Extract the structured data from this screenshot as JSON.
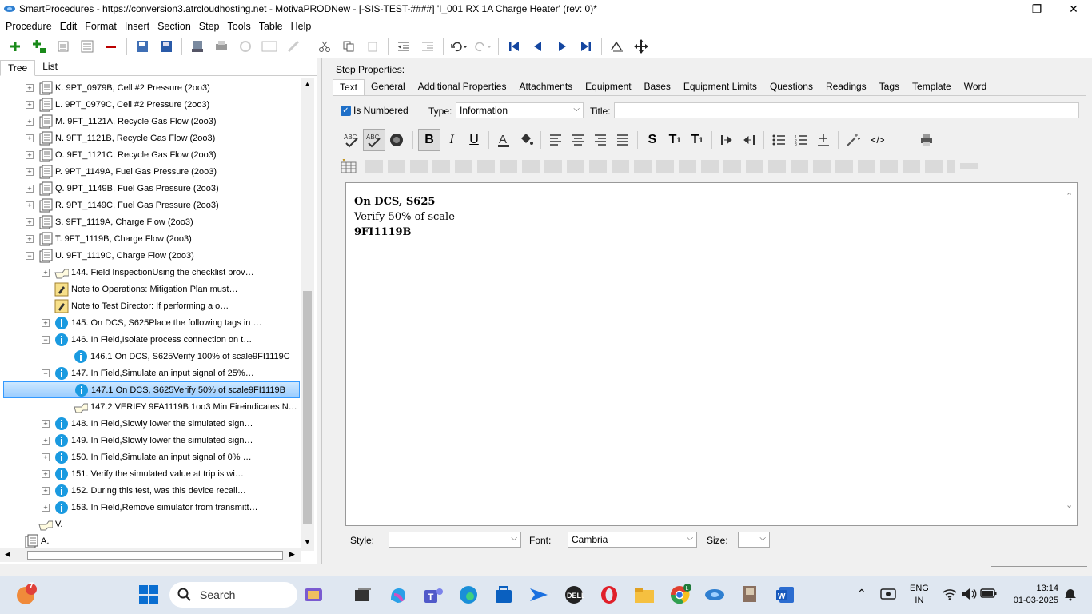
{
  "window": {
    "title": "SmartProcedures - https://conversion3.atrcloudhosting.net - MotivaPRODNew - [-SIS-TEST-####] 'I_001 RX 1A Charge Heater' (rev: 0)*",
    "minimize": "—",
    "restore": "❐",
    "close": "✕"
  },
  "menu": [
    "Procedure",
    "Edit",
    "Format",
    "Insert",
    "Section",
    "Step",
    "Tools",
    "Table",
    "Help"
  ],
  "left_tabs": [
    "Tree",
    "List"
  ],
  "tree": [
    {
      "expander": "+",
      "label": "K. 9PT_0979B, Cell #2 Pressure (2oo3)",
      "icon": "doc-icon",
      "indent": 0
    },
    {
      "expander": "+",
      "label": "L. 9PT_0979C, Cell #2 Pressure (2oo3)",
      "icon": "doc-icon",
      "indent": 0
    },
    {
      "expander": "+",
      "label": "M. 9FT_1121A, Recycle Gas Flow (2oo3)",
      "icon": "doc-icon",
      "indent": 0
    },
    {
      "expander": "+",
      "label": "N. 9FT_1121B, Recycle Gas Flow (2oo3)",
      "icon": "doc-icon",
      "indent": 0
    },
    {
      "expander": "+",
      "label": "O. 9FT_1121C, Recycle Gas Flow (2oo3)",
      "icon": "doc-icon",
      "indent": 0
    },
    {
      "expander": "+",
      "label": "P. 9PT_1149A, Fuel Gas Pressure (2oo3)",
      "icon": "doc-icon",
      "indent": 0
    },
    {
      "expander": "+",
      "label": "Q. 9PT_1149B, Fuel Gas Pressure (2oo3)",
      "icon": "doc-icon",
      "indent": 0
    },
    {
      "expander": "+",
      "label": "R. 9PT_1149C, Fuel Gas Pressure (2oo3)",
      "icon": "doc-icon",
      "indent": 0
    },
    {
      "expander": "+",
      "label": "S. 9FT_1119A, Charge Flow (2oo3)",
      "icon": "doc-icon",
      "indent": 0
    },
    {
      "expander": "+",
      "label": "T. 9FT_1119B, Charge Flow (2oo3)",
      "icon": "doc-icon",
      "indent": 0
    },
    {
      "expander": "−",
      "label": "U. 9FT_1119C, Charge Flow (2oo3)",
      "icon": "doc-icon",
      "indent": 0
    },
    {
      "expander": "+",
      "label": "144. Field InspectionUsing the checklist prov…",
      "icon": "hand-icon",
      "indent": 1
    },
    {
      "expander": "",
      "label": "Note to Operations: Mitigation Plan must…",
      "icon": "note-icon",
      "indent": 1
    },
    {
      "expander": "",
      "label": "Note to Test Director: If performing a o…",
      "icon": "note-icon",
      "indent": 1
    },
    {
      "expander": "+",
      "label": "145. On DCS, S625Place the following tags in …",
      "icon": "info-icon",
      "indent": 1
    },
    {
      "expander": "−",
      "label": "146. In Field,Isolate process connection on t…",
      "icon": "info-icon",
      "indent": 1
    },
    {
      "expander": "",
      "label": "146.1 On DCS, S625Verify 100% of scale9FI1119C",
      "icon": "info-icon",
      "indent": 2
    },
    {
      "expander": "−",
      "label": "147. In Field,Simulate an input signal of 25%…",
      "icon": "info-icon",
      "indent": 1
    },
    {
      "expander": "",
      "label": "147.1 On DCS, S625Verify 50% of scale9FI1119B",
      "icon": "info-icon",
      "indent": 2,
      "selected": true
    },
    {
      "expander": "",
      "label": "147.2 VERIFY 9FA1119B 1oo3 Min Fireindicates N…",
      "icon": "hand-icon",
      "indent": 2
    },
    {
      "expander": "+",
      "label": "148. In Field,Slowly lower the simulated sign…",
      "icon": "info-icon",
      "indent": 1
    },
    {
      "expander": "+",
      "label": "149. In Field,Slowly lower the simulated sign…",
      "icon": "info-icon",
      "indent": 1
    },
    {
      "expander": "+",
      "label": "150. In Field,Simulate an input signal of 0% …",
      "icon": "info-icon",
      "indent": 1
    },
    {
      "expander": "+",
      "label": "151. Verify the simulated value at trip is wi…",
      "icon": "info-icon",
      "indent": 1
    },
    {
      "expander": "+",
      "label": "152. During this test, was this device recali…",
      "icon": "info-icon",
      "indent": 1
    },
    {
      "expander": "+",
      "label": "153. In Field,Remove simulator from transmitt…",
      "icon": "info-icon",
      "indent": 1
    },
    {
      "expander": "",
      "label": "V.",
      "icon": "hand-icon",
      "indent": 0
    },
    {
      "expander": "",
      "label": "A.",
      "icon": "doc-icon",
      "indent": -1
    }
  ],
  "step_properties": {
    "label": "Step Properties:",
    "tabs": [
      "Text",
      "General",
      "Additional Properties",
      "Attachments",
      "Equipment",
      "Bases",
      "Equipment Limits",
      "Questions",
      "Readings",
      "Tags",
      "Template",
      "Word"
    ],
    "is_numbered_label": "Is Numbered",
    "is_numbered": true,
    "type_label": "Type:",
    "type_value": "Information",
    "title_label": "Title:",
    "title_value": ""
  },
  "editor": {
    "line1": "On DCS, S625",
    "line2": "Verify 50% of scale",
    "line3": "9FI1119B"
  },
  "bottom": {
    "style_label": "Style:",
    "style_value": "",
    "font_label": "Font:",
    "font_value": "Cambria",
    "size_label": "Size:",
    "size_value": ""
  },
  "taskbar": {
    "weather_badge": "7",
    "search_label": "Search",
    "lang1": "ENG",
    "lang2": "IN",
    "time": "13:14",
    "date": "01-03-2025"
  },
  "colors": {
    "selection": "#99ccff",
    "checkbox": "#1e6fc8",
    "info_icon": "#1a9ae0",
    "taskbar_bg": "#dfe7f1"
  }
}
